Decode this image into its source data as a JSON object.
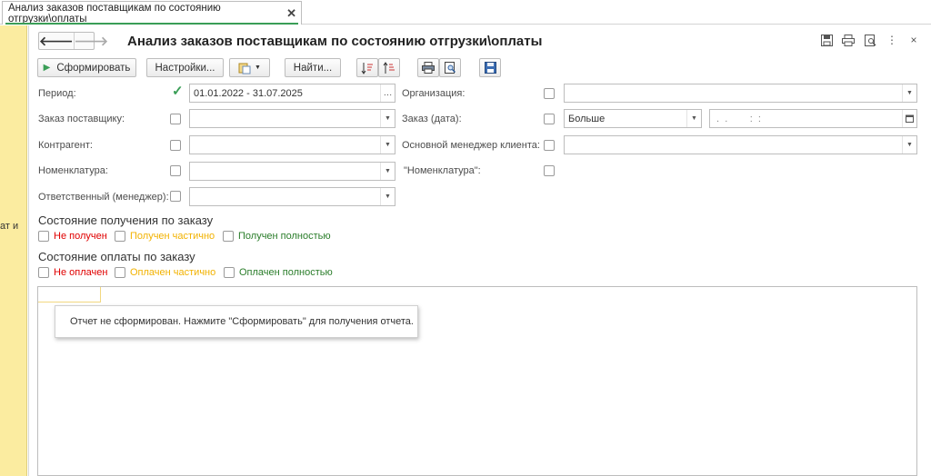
{
  "tab": {
    "title": "Анализ заказов поставщикам по состоянию отгрузки\\оплаты",
    "close_glyph": "✕"
  },
  "left_panel": {
    "text": "ат и"
  },
  "form": {
    "title": "Анализ заказов поставщикам по состоянию отгрузки\\оплаты",
    "nav": {
      "back": "🡐",
      "forward": "🡒"
    },
    "header_icons": [
      "save-icon",
      "print-icon",
      "preview-icon",
      "more-icon",
      "close-icon"
    ],
    "header_glyphs": {
      "more": "⋮",
      "close": "×"
    }
  },
  "toolbar": {
    "generate_label": "Сформировать",
    "settings_label": "Настройки...",
    "find_label": "Найти..."
  },
  "fields": {
    "period": {
      "label": "Период:",
      "checked": true,
      "value": "01.01.2022 - 31.07.2025"
    },
    "organization": {
      "label": "Организация:",
      "checked": false,
      "value": ""
    },
    "supplier_order": {
      "label": "Заказ поставщику:",
      "checked": false,
      "value": ""
    },
    "order_date": {
      "label": "Заказ (дата):",
      "checked": false,
      "condition": "Больше",
      "date_value": " .  .        :  :"
    },
    "counterparty": {
      "label": "Контрагент:",
      "checked": false,
      "value": ""
    },
    "main_manager": {
      "label": "Основной менеджер клиента:",
      "checked": false,
      "value": ""
    },
    "nomenclature": {
      "label": "Номенклатура:",
      "checked": false,
      "value": ""
    },
    "nomenclature_quoted": {
      "label": "\"Номенклатура\":",
      "checked": false
    },
    "responsible": {
      "label": "Ответственный (менеджер):",
      "checked": false,
      "value": ""
    }
  },
  "receipt_state": {
    "title": "Состояние получения по заказу",
    "options": [
      {
        "label": "Не получен",
        "color": "#e00000"
      },
      {
        "label": "Получен частично",
        "color": "#f2b200"
      },
      {
        "label": "Получен полностью",
        "color": "#2a7d2a"
      }
    ]
  },
  "payment_state": {
    "title": "Состояние оплаты по заказу",
    "options": [
      {
        "label": "Не оплачен",
        "color": "#e00000"
      },
      {
        "label": "Оплачен частично",
        "color": "#f2b200"
      },
      {
        "label": "Оплачен полностью",
        "color": "#2a7d2a"
      }
    ]
  },
  "report": {
    "message": "Отчет не сформирован. Нажмите \"Сформировать\" для получения отчета."
  },
  "colors": {
    "accent": "#3a9e57",
    "left_panel": "#fbeca0"
  }
}
